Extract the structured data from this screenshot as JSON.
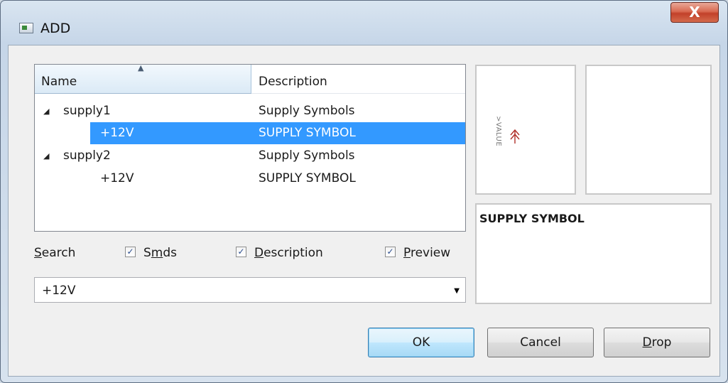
{
  "window": {
    "title": "ADD",
    "close_glyph": "X"
  },
  "list": {
    "columns": [
      "Name",
      "Description"
    ],
    "rows": [
      {
        "name": "supply1",
        "description": "Supply Symbols",
        "expander": "◢",
        "level": 0,
        "selected": false
      },
      {
        "name": "+12V",
        "description": "SUPPLY SYMBOL",
        "expander": "",
        "level": 1,
        "selected": true
      },
      {
        "name": "supply2",
        "description": "Supply Symbols",
        "expander": "◢",
        "level": 0,
        "selected": false
      },
      {
        "name": "+12V",
        "description": "SUPPLY SYMBOL",
        "expander": "",
        "level": 1,
        "selected": false
      }
    ]
  },
  "search": {
    "label_ul": "S",
    "label_rest": "earch",
    "smds": {
      "pre": "S",
      "ul": "m",
      "post": "ds",
      "checked": true
    },
    "description": {
      "pre": "",
      "ul": "D",
      "post": "escription",
      "checked": true
    },
    "preview": {
      "pre": "",
      "ul": "P",
      "post": "review",
      "checked": true
    },
    "check_glyph": "✓",
    "value": "+12V",
    "dropdown_glyph": "▼"
  },
  "preview": {
    "symbol_value_text": ">VALUE",
    "symbol_color": "#b0302a",
    "description_text": "SUPPLY SYMBOL"
  },
  "buttons": {
    "ok": "OK",
    "cancel": "Cancel",
    "drop_ul": "D",
    "drop_rest": "rop"
  },
  "colors": {
    "selection": "#3399ff",
    "accent_header": "#dbeaf6"
  }
}
